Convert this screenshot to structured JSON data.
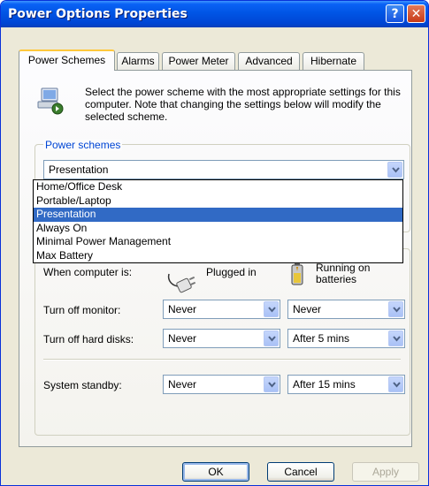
{
  "window": {
    "title": "Power Options Properties",
    "help_glyph": "?",
    "close_glyph": "✕"
  },
  "tabs": [
    {
      "label": "Power Schemes",
      "active": true
    },
    {
      "label": "Alarms"
    },
    {
      "label": "Power Meter"
    },
    {
      "label": "Advanced"
    },
    {
      "label": "Hibernate"
    }
  ],
  "description": "Select the power scheme with the most appropriate settings for this computer. Note that changing the settings below will modify the selected scheme.",
  "power_schemes": {
    "group_label": "Power schemes",
    "selected": "Presentation",
    "options": [
      "Home/Office Desk",
      "Portable/Laptop",
      "Presentation",
      "Always On",
      "Minimal Power Management",
      "Max Battery"
    ]
  },
  "settings": {
    "when_label": "When computer is:",
    "plugged_in": "Plugged in",
    "batteries": "Running on\nbatteries",
    "rows": [
      {
        "label": "Turn off monitor:",
        "plugged": "Never",
        "battery": "Never"
      },
      {
        "label": "Turn off hard disks:",
        "plugged": "Never",
        "battery": "After 5 mins"
      },
      {
        "label": "System standby:",
        "plugged": "Never",
        "battery": "After 15 mins"
      }
    ]
  },
  "buttons": {
    "ok": "OK",
    "cancel": "Cancel",
    "apply": "Apply"
  },
  "colors": {
    "title_bar": "#0055e5",
    "selection": "#316ac5",
    "group_label": "#0046d5"
  },
  "icons": {
    "scheme": "power-scheme-icon",
    "plug": "plug-icon",
    "battery": "battery-icon",
    "dropdown_arrow": "chevron-down-icon"
  }
}
